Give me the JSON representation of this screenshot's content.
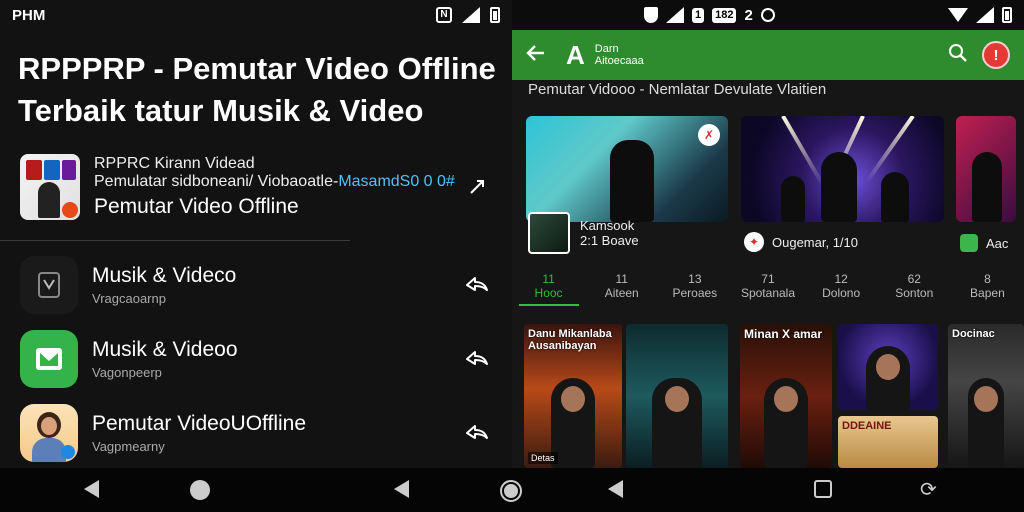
{
  "left": {
    "status": {
      "time": "PHM"
    },
    "heading": "RPPPRP - Pemutar Video Offline Terbaik tatur Musik & Video",
    "featured": {
      "line1": "RPPRC Kirann Videad",
      "line2_prefix": "Pemulatar sidboneani/ Viobaoatle-",
      "line2_link": "MasamdS0 0 0#",
      "title": "Pemutar Video Offline"
    },
    "items": [
      {
        "title": "Musik & Videco",
        "sub": "Vragcaoarnp"
      },
      {
        "title": "Musik & Videoo",
        "sub": "Vagonpeerp"
      },
      {
        "title": "Pemutar VideoUOffline",
        "sub": "Vagpmearny"
      }
    ]
  },
  "right": {
    "status": {
      "pill1": "1",
      "pill2": "182",
      "num": "2"
    },
    "appbar": {
      "logo": "A",
      "title_line1": "Darn",
      "title_line2": "Aitoecaaa",
      "alert": "!"
    },
    "section": "Pemutar Vidooo - Nemlatar Devulate Vlaitien",
    "card_badge": "✗",
    "cards_meta": [
      {
        "title": "Kamsook",
        "sub": "2:1 Boave"
      },
      {
        "title": "Ougemar, 1/10"
      },
      {
        "title": "Aac"
      }
    ],
    "tabs": [
      {
        "num": "11",
        "label": "Hooc"
      },
      {
        "num": "11",
        "label": "Aiteen"
      },
      {
        "num": "13",
        "label": "Peroaes"
      },
      {
        "num": "71",
        "label": "Spotanala"
      },
      {
        "num": "12",
        "label": "Dolono"
      },
      {
        "num": "62",
        "label": "Sonton"
      },
      {
        "num": "8",
        "label": "Bapen"
      }
    ],
    "posters": [
      {
        "title": "Danu Mikanlaba Ausanibayan",
        "tag": "Detas"
      },
      {
        "title": ""
      },
      {
        "title": "Minan X amar"
      },
      {
        "title": ""
      },
      {
        "title": "DDEAINE"
      },
      {
        "title": "Docinac"
      }
    ]
  }
}
